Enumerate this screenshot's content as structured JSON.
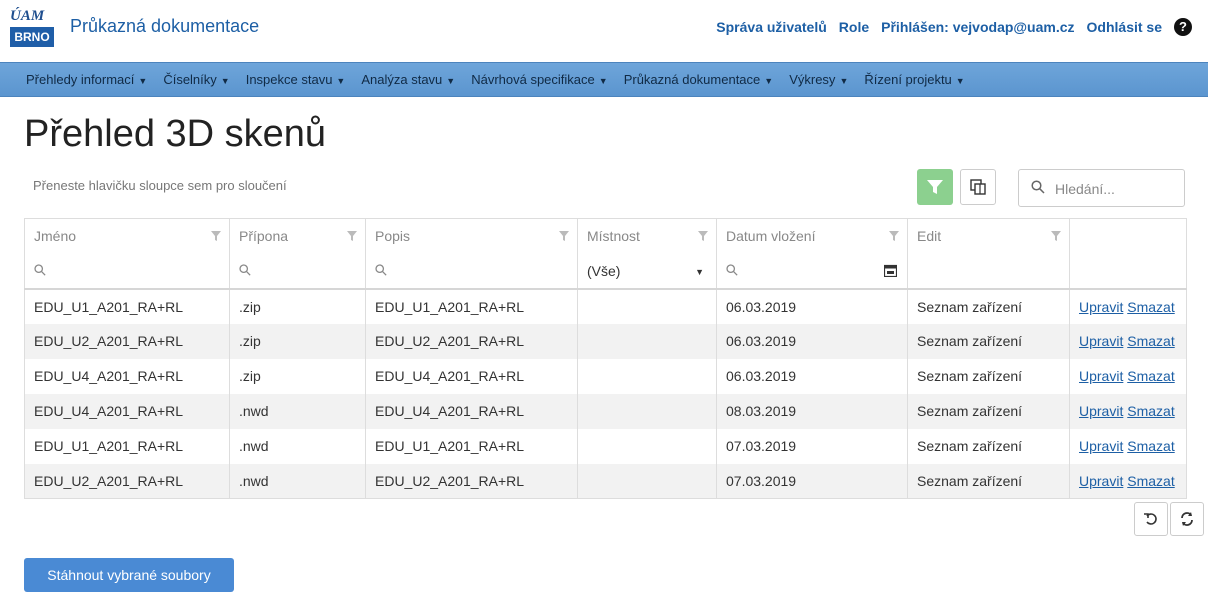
{
  "header": {
    "logo_top": "ÚAM",
    "logo_bottom": "BRNO",
    "app_title": "Průkazná dokumentace",
    "links": {
      "users": "Správa uživatelů",
      "role": "Role",
      "logged_in": "Přihlášen: vejvodap@uam.cz",
      "logout": "Odhlásit se"
    }
  },
  "nav": [
    "Přehledy informací",
    "Číselníky",
    "Inspekce stavu",
    "Analýza stavu",
    "Návrhová specifikace",
    "Průkazná dokumentace",
    "Výkresy",
    "Řízení projektu"
  ],
  "page_title": "Přehled 3D skenů",
  "group_panel": "Přeneste hlavičku sloupce sem pro sloučení",
  "search": {
    "placeholder": "Hledání..."
  },
  "table": {
    "columns": [
      "Jméno",
      "Přípona",
      "Popis",
      "Místnost",
      "Datum vložení",
      "Edit"
    ],
    "filter_select": "(Vše)",
    "rows": [
      {
        "name": "EDU_U1_A201_RA+RL",
        "ext": ".zip",
        "desc": "EDU_U1_A201_RA+RL",
        "room": "",
        "date": "06.03.2019",
        "edit": "Seznam zařízení",
        "upravit": "Upravit",
        "smazat": "Smazat"
      },
      {
        "name": "EDU_U2_A201_RA+RL",
        "ext": ".zip",
        "desc": "EDU_U2_A201_RA+RL",
        "room": "",
        "date": "06.03.2019",
        "edit": "Seznam zařízení",
        "upravit": "Upravit",
        "smazat": "Smazat"
      },
      {
        "name": "EDU_U4_A201_RA+RL",
        "ext": ".zip",
        "desc": "EDU_U4_A201_RA+RL",
        "room": "",
        "date": "06.03.2019",
        "edit": "Seznam zařízení",
        "upravit": "Upravit",
        "smazat": "Smazat"
      },
      {
        "name": "EDU_U4_A201_RA+RL",
        "ext": ".nwd",
        "desc": "EDU_U4_A201_RA+RL",
        "room": "",
        "date": "08.03.2019",
        "edit": "Seznam zařízení",
        "upravit": "Upravit",
        "smazat": "Smazat"
      },
      {
        "name": "EDU_U1_A201_RA+RL",
        "ext": ".nwd",
        "desc": "EDU_U1_A201_RA+RL",
        "room": "",
        "date": "07.03.2019",
        "edit": "Seznam zařízení",
        "upravit": "Upravit",
        "smazat": "Smazat"
      },
      {
        "name": "EDU_U2_A201_RA+RL",
        "ext": ".nwd",
        "desc": "EDU_U2_A201_RA+RL",
        "room": "",
        "date": "07.03.2019",
        "edit": "Seznam zařízení",
        "upravit": "Upravit",
        "smazat": "Smazat"
      }
    ]
  },
  "download_button": "Stáhnout vybrané soubory",
  "colors": {
    "brand_blue": "#1d5fa5",
    "navbar": "#6ea5da",
    "filter_active": "#8cd08f",
    "button": "#4a8ad4"
  },
  "icons": [
    "help-icon",
    "filter-icon",
    "column-chooser-icon",
    "search-icon",
    "funnel-icon",
    "calendar-icon",
    "undo-icon",
    "refresh-icon"
  ]
}
